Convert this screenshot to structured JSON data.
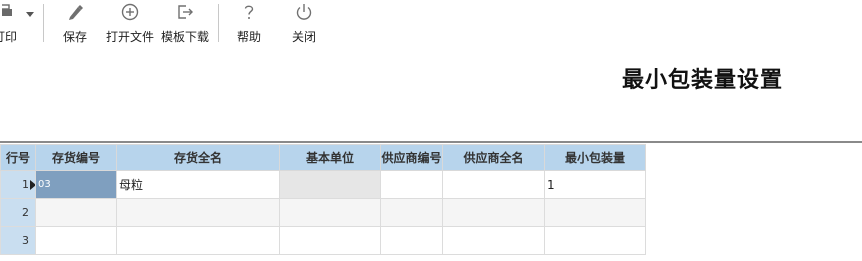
{
  "toolbar": {
    "print_label": "打印",
    "save_label": "保存",
    "open_file_label": "打开文件",
    "template_download_label": "模板下载",
    "help_label": "帮助",
    "close_label": "关闭"
  },
  "page_title": "最小包装量设置",
  "grid": {
    "columns": [
      "行号",
      "存货编号",
      "存货全名",
      "基本单位",
      "供应商编号",
      "供应商全名",
      "最小包装量"
    ],
    "rows": [
      {
        "no": "1",
        "code": "03",
        "name": "母粒",
        "unit": "",
        "supplier_code": "",
        "supplier_name": "",
        "min_qty": "1"
      },
      {
        "no": "2",
        "code": "",
        "name": "",
        "unit": "",
        "supplier_code": "",
        "supplier_name": "",
        "min_qty": ""
      },
      {
        "no": "3",
        "code": "",
        "name": "",
        "unit": "",
        "supplier_code": "",
        "supplier_name": "",
        "min_qty": ""
      }
    ]
  }
}
